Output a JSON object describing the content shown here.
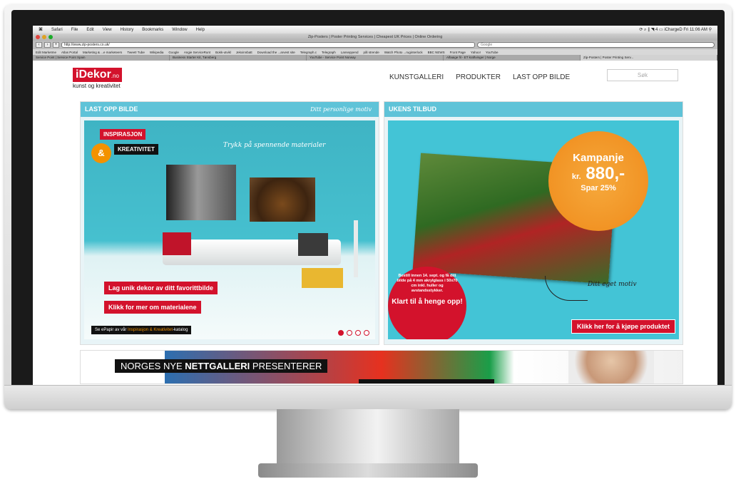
{
  "menubar": {
    "apple": "⌘",
    "items": [
      "Safari",
      "File",
      "Edit",
      "View",
      "History",
      "Bookmarks",
      "Window",
      "Help"
    ],
    "status": "⟳ ⌕ ∥ ◥ 4 ▭ iChargeD Fri 11:06 AM ⚲"
  },
  "browser": {
    "window_title": "Zip-Posters | Poster Printing Services | Cheapest UK Prices | Online Ordering",
    "url": "http://www.zip-posters.co.uk/",
    "search_placeholder": "Google",
    "bookmarks": [
      "Edit Marketme",
      "Atlas Portal",
      "Marketing & ...e marketeers",
      "Tweet! Tube",
      "Wikipedia",
      "Google",
      "Angie ServiceRunt",
      "Bokk-utvikl",
      "Jekxinnbatt",
      "Download the ...arvest site",
      "Telegraph.c",
      "Telegraph",
      "Lanseppend",
      "pål strende",
      "Watch Photo ...ruginterlock",
      "BBC NEWS",
      "Front Page",
      "Yahoo!",
      "YouTube"
    ],
    "tabs": [
      "Service Point | Service Point Spain",
      "Business Starter Kit, Tønsberg",
      "YouTube - Service Point Norway",
      "Alfaaige fil - ET kraftvinger | Norge",
      "Zip-Posters | Poster Printing Serv..."
    ]
  },
  "site": {
    "logo": "iDekor",
    "logo_suffix": ".no",
    "tagline": "kunst og kreativitet",
    "nav": [
      "KUNSTGALLERI",
      "PRODUKTER",
      "LAST OPP BILDE"
    ],
    "search_placeholder": "Søk",
    "left_panel": {
      "title": "LAST OPP BILDE",
      "script_title": "Ditt personlige motiv",
      "tag_inspiration": "INSPIRASJON",
      "ampersand": "&",
      "tag_creativity": "KREATIVITET",
      "script_materials": "Trykk på spennende materialer",
      "cta_1": "Lag unik dekor av ditt favorittbilde",
      "cta_2": "Klikk for mer om materialene",
      "catalog_prefix": "Se ePapir av vår ",
      "catalog_highlight": "Inspirasjon & Kreativitet",
      "catalog_suffix": "-katalog"
    },
    "right_panel": {
      "title": "UKENS TILBUD",
      "burst_title": "Kampanje",
      "burst_currency": "kr.",
      "burst_price": "880,-",
      "burst_discount": "Spar 25%",
      "order_text": "Bestill innen 14. sept. og få ditt bilde på 4 mm akrylglass i 50x70 cm inkl. huller og avstandsstykker.",
      "order_highlight": "Klart til å henge opp!",
      "own_motif": "Ditt eget motiv",
      "buy_button": "Klikk her for å kjøpe produktet"
    },
    "banner": {
      "prefix": "NORGES NYE ",
      "bold": "NETTGALLERI",
      "suffix": " PRESENTERER"
    }
  }
}
